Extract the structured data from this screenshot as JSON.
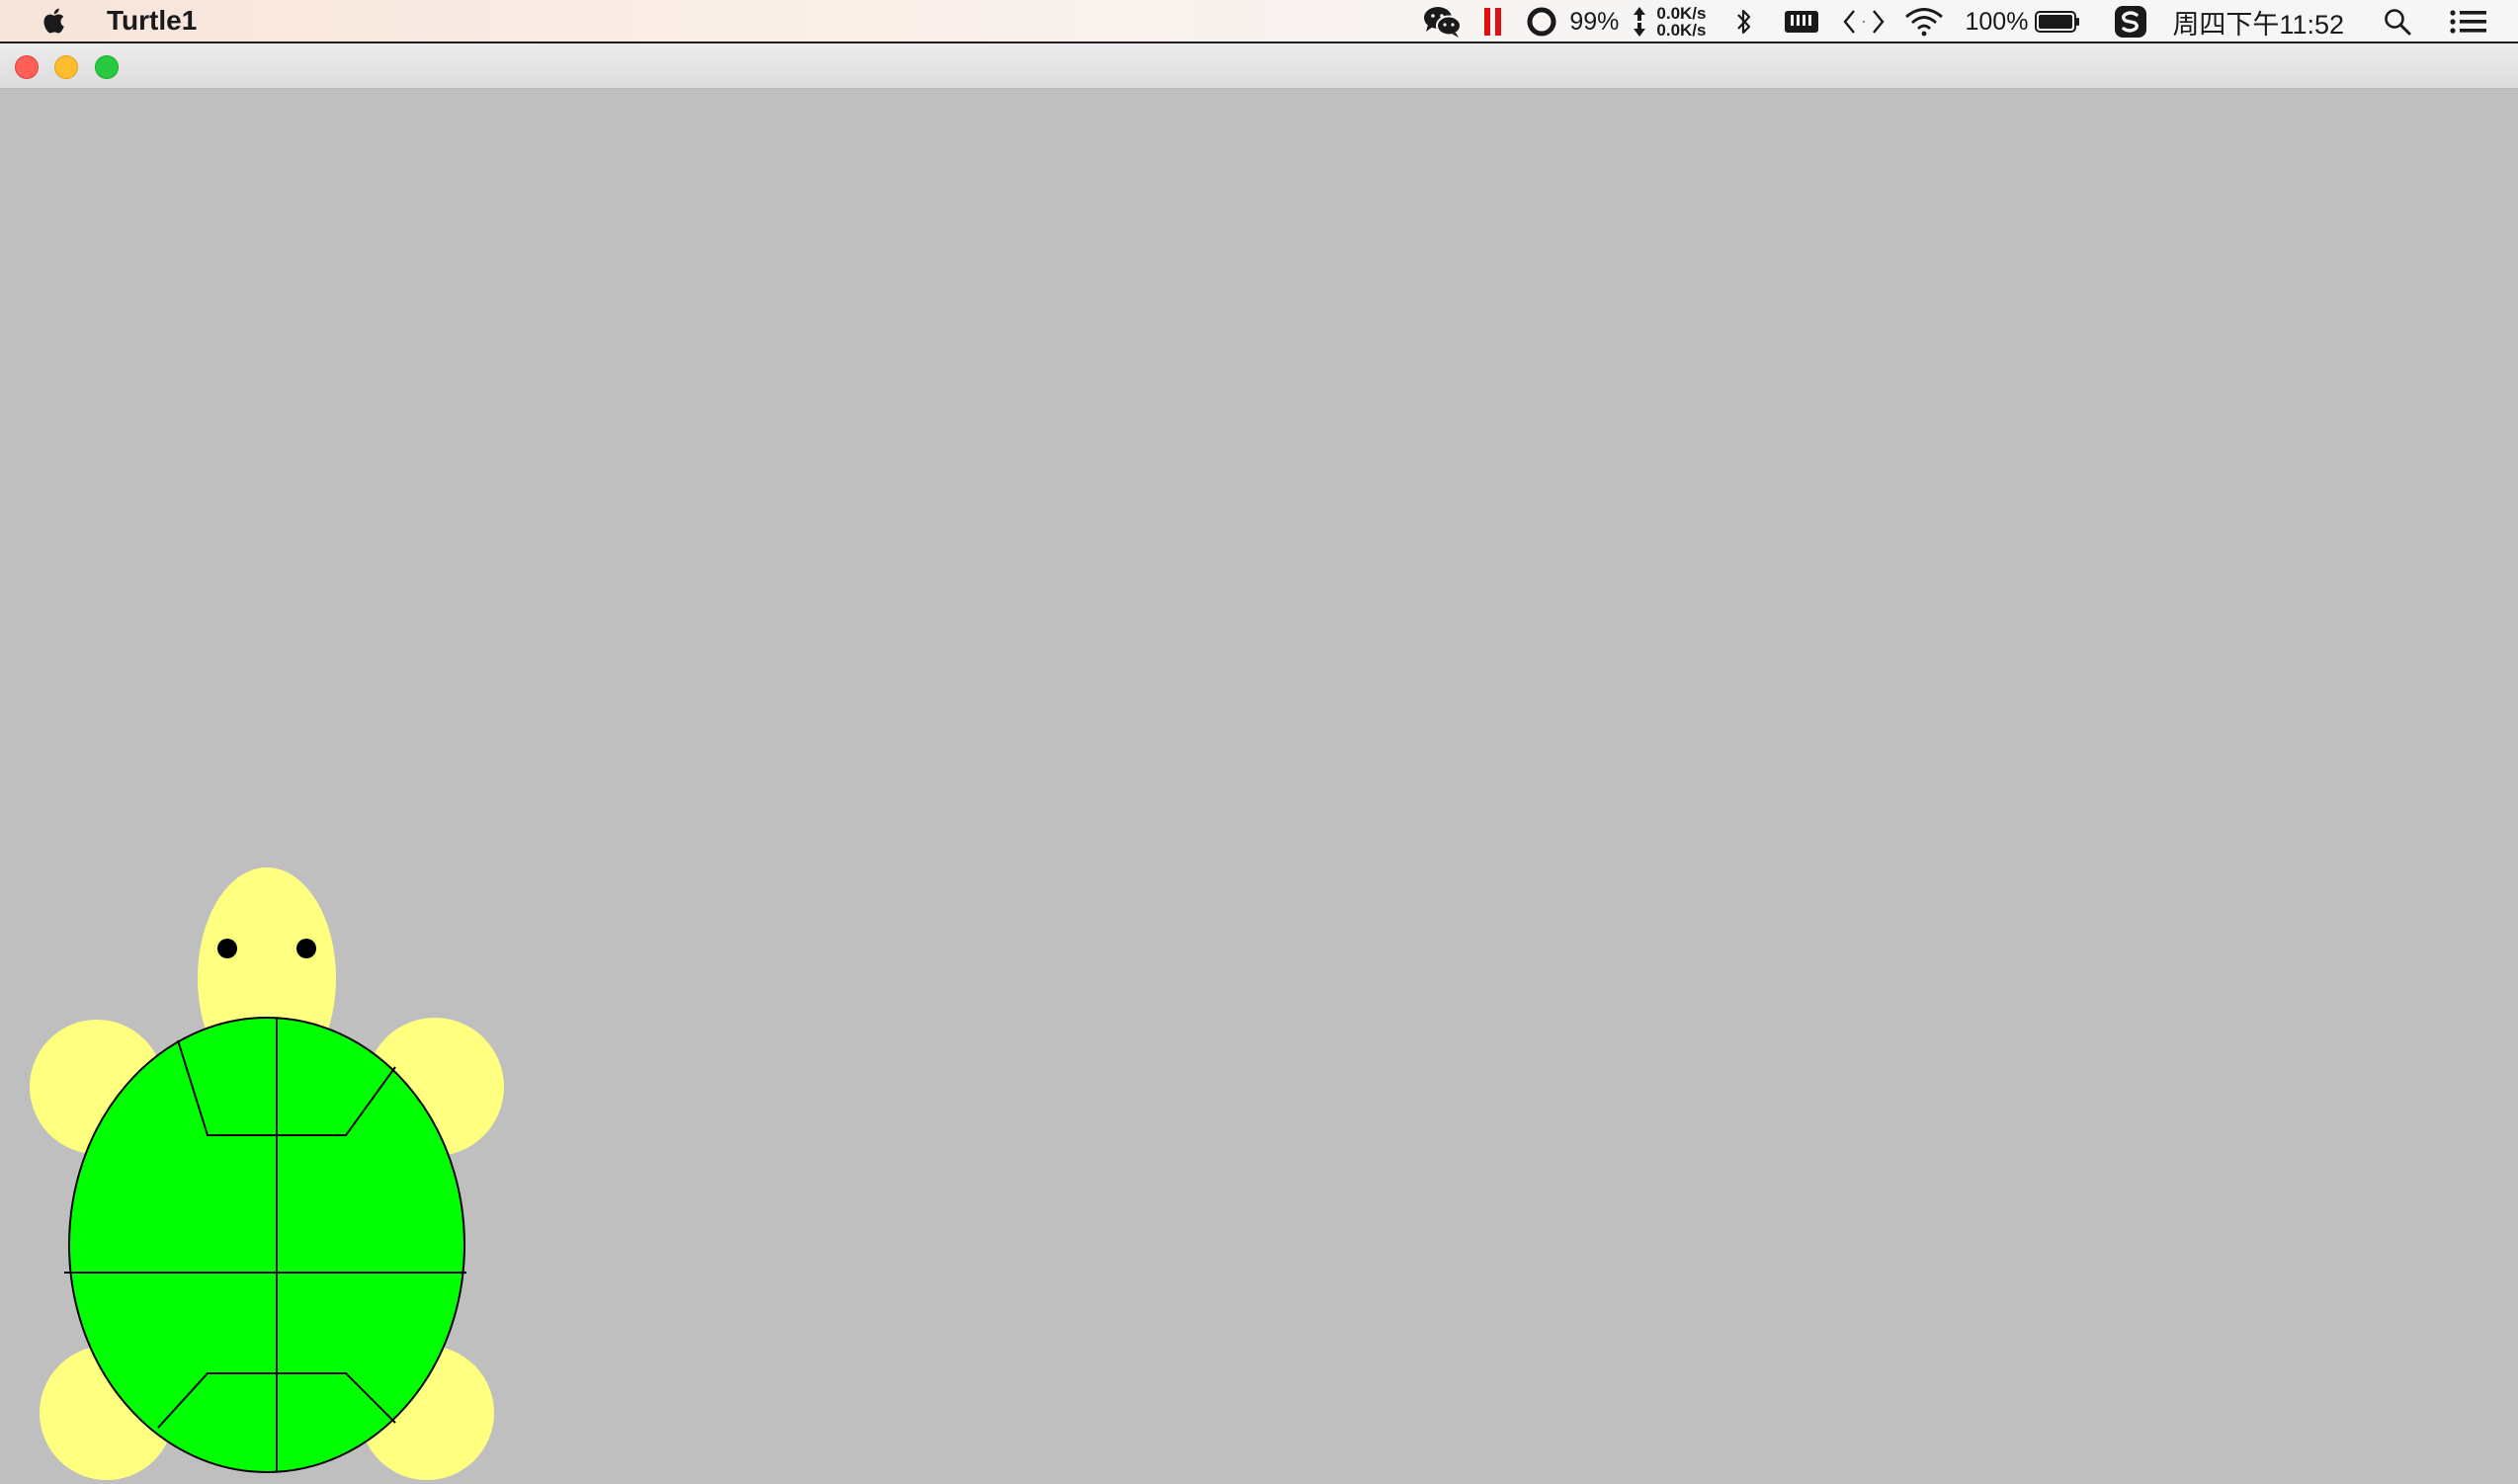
{
  "menubar": {
    "app_name": "Turtle1",
    "cpu_percent": "99%",
    "net_up": "0.0K/s",
    "net_down": "0.0K/s",
    "battery_percent": "100%",
    "clock": "周四下午11:52",
    "icons": [
      "apple-icon",
      "wechat-icon",
      "pause-icon",
      "record-icon",
      "network-arrows-icon",
      "bluetooth-icon",
      "memory-icon",
      "code-icon",
      "wifi-icon",
      "battery-icon",
      "sogou-input-icon",
      "spotlight-search-icon",
      "notification-center-icon"
    ]
  },
  "window": {
    "traffic_lights": [
      "close",
      "minimize",
      "zoom"
    ]
  },
  "colors": {
    "canvas_bg": "#bfbfbf",
    "shell_fill": "#00ff00",
    "limb_fill": "#ffff80",
    "outline": "#000000"
  }
}
